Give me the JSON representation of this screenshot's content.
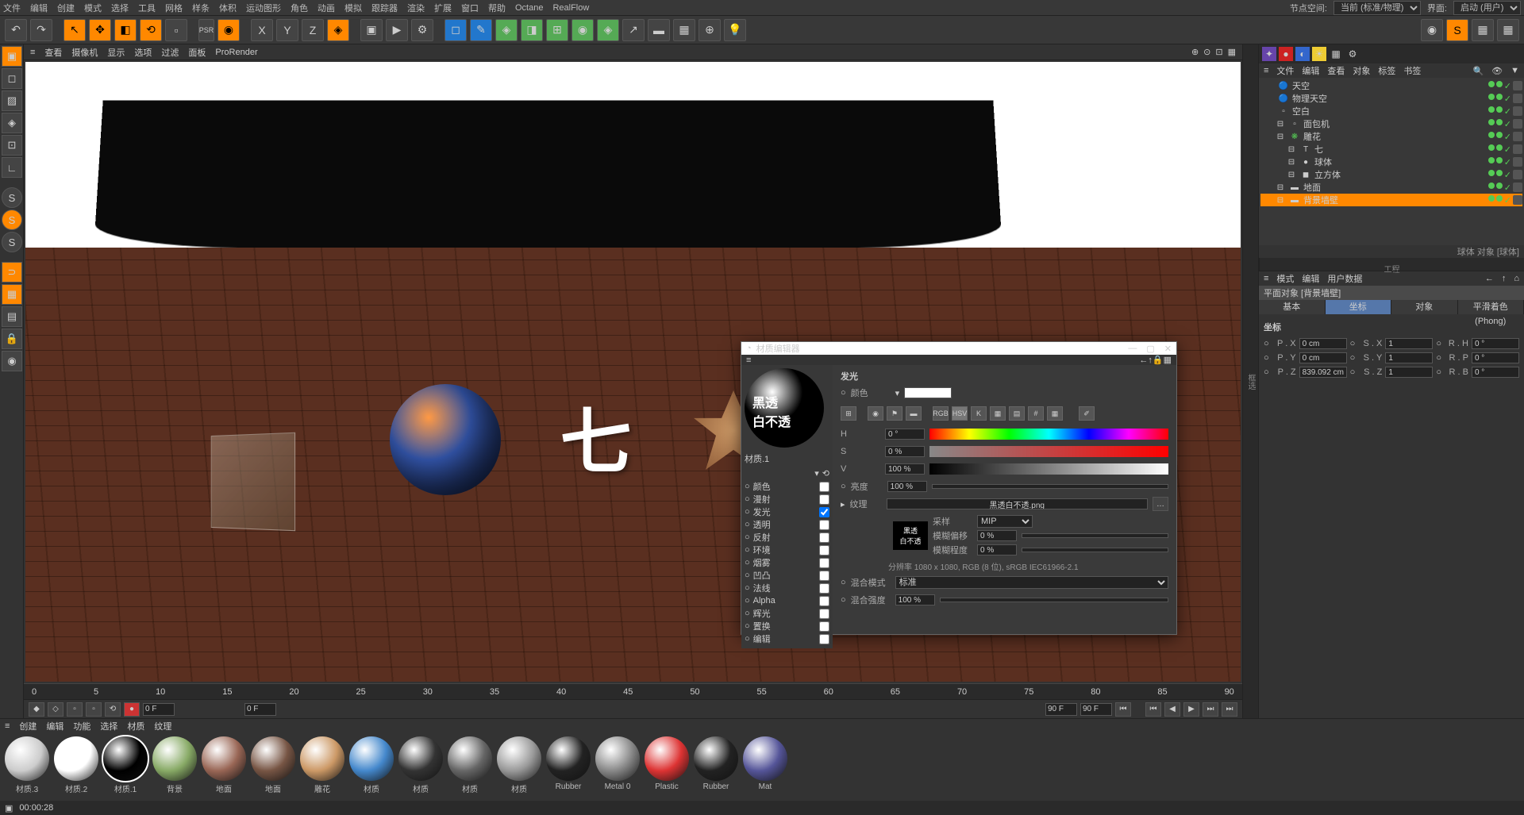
{
  "menu": {
    "items": [
      "文件",
      "编辑",
      "创建",
      "模式",
      "选择",
      "工具",
      "网格",
      "样条",
      "体积",
      "运动图形",
      "角色",
      "动画",
      "模拟",
      "跟踪器",
      "渲染",
      "扩展",
      "窗口",
      "帮助",
      "Octane",
      "RealFlow"
    ],
    "node_space_label": "节点空间:",
    "node_space_value": "当前 (标准/物理)",
    "layout_label": "界面:",
    "layout_value": "启动 (用户)"
  },
  "viewport_menu": {
    "items": [
      "查看",
      "摄像机",
      "显示",
      "选项",
      "过滤",
      "面板",
      "ProRender"
    ]
  },
  "timeline": {
    "marks": [
      "0",
      "5",
      "10",
      "15",
      "20",
      "25",
      "30",
      "35",
      "40",
      "45",
      "50",
      "55",
      "60",
      "65",
      "70",
      "75",
      "80",
      "85",
      "90"
    ],
    "start": "0 F",
    "current": "0 F",
    "end": "90 F",
    "end2": "90 F"
  },
  "objects": {
    "menu": [
      "文件",
      "编辑",
      "查看",
      "对象",
      "标签",
      "书签"
    ],
    "tree": [
      {
        "icon": "🔵",
        "name": "天空",
        "indent": 0
      },
      {
        "icon": "🔵",
        "name": "物理天空",
        "indent": 0
      },
      {
        "icon": "▫",
        "name": "空白",
        "indent": 0,
        "bold": true
      },
      {
        "icon": "▫",
        "name": "面包机",
        "indent": 1
      },
      {
        "icon": "❋",
        "name": "雕花",
        "indent": 1,
        "green": true
      },
      {
        "icon": "T",
        "name": "七",
        "indent": 2
      },
      {
        "icon": "●",
        "name": "球体",
        "indent": 2
      },
      {
        "icon": "◼",
        "name": "立方体",
        "indent": 2
      },
      {
        "icon": "▬",
        "name": "地面",
        "indent": 1
      },
      {
        "icon": "▬",
        "name": "背景墙壁",
        "indent": 1,
        "sel": true
      }
    ],
    "status": "球体 对象 [球体]"
  },
  "attr": {
    "menu": [
      "模式",
      "编辑",
      "用户数据"
    ],
    "head": "平面对象 [背景墙壁]",
    "tabs": [
      "基本",
      "坐标",
      "对象",
      "平滑着色(Phong)"
    ],
    "group": "坐标",
    "rows": [
      {
        "k1": "P . X",
        "v1": "0 cm",
        "k2": "S . X",
        "v2": "1",
        "k3": "R . H",
        "v3": "0 °"
      },
      {
        "k1": "P . Y",
        "v1": "0 cm",
        "k2": "S . Y",
        "v2": "1",
        "k3": "R . P",
        "v3": "0 °"
      },
      {
        "k1": "P . Z",
        "v1": "839.092 cm",
        "k2": "S . Z",
        "v2": "1",
        "k3": "R . B",
        "v3": "0 °"
      }
    ]
  },
  "materials": {
    "menu": [
      "创建",
      "编辑",
      "功能",
      "选择",
      "材质",
      "纹理"
    ],
    "items": [
      "材质.3",
      "材质.2",
      "材质.1",
      "背景",
      "地面",
      "地面",
      "雕花",
      "材质",
      "材质",
      "材质",
      "材质",
      "Rubber",
      "Metal 0",
      "Plastic",
      "Rubber",
      "Mat"
    ],
    "selected": 2
  },
  "mat_editor": {
    "title": "材质编辑器",
    "name": "材质.1",
    "channels": [
      "颜色",
      "漫射",
      "发光",
      "透明",
      "反射",
      "环境",
      "烟雾",
      "凹凸",
      "法线",
      "Alpha",
      "辉光",
      "置换",
      "编辑"
    ],
    "active_channel": "发光",
    "section": "发光",
    "color_label": "颜色",
    "H": "0 °",
    "S": "0 %",
    "V": "100 %",
    "brightness_label": "亮度",
    "brightness": "100 %",
    "texture_label": "纹理",
    "texture_file": "黑透白不透.png",
    "sample_label": "采样",
    "sample_value": "MIP",
    "blur_offset_label": "模糊偏移",
    "blur_offset": "0 %",
    "blur_scale_label": "模糊程度",
    "blur_scale": "0 %",
    "tex_info": "分辨率 1080 x 1080, RGB (8 位), sRGB IEC61966-2.1",
    "blend_mode_label": "混合模式",
    "blend_mode": "标准",
    "blend_strength_label": "混合强度",
    "blend_strength": "100 %",
    "icon_labels": [
      "RGB",
      "HSV",
      "K",
      "▦",
      "▤",
      "#",
      "▦"
    ]
  },
  "right_tabs": [
    "框选",
    "工程"
  ],
  "status_bar": {
    "time": "00:00:28"
  },
  "seven": "七"
}
